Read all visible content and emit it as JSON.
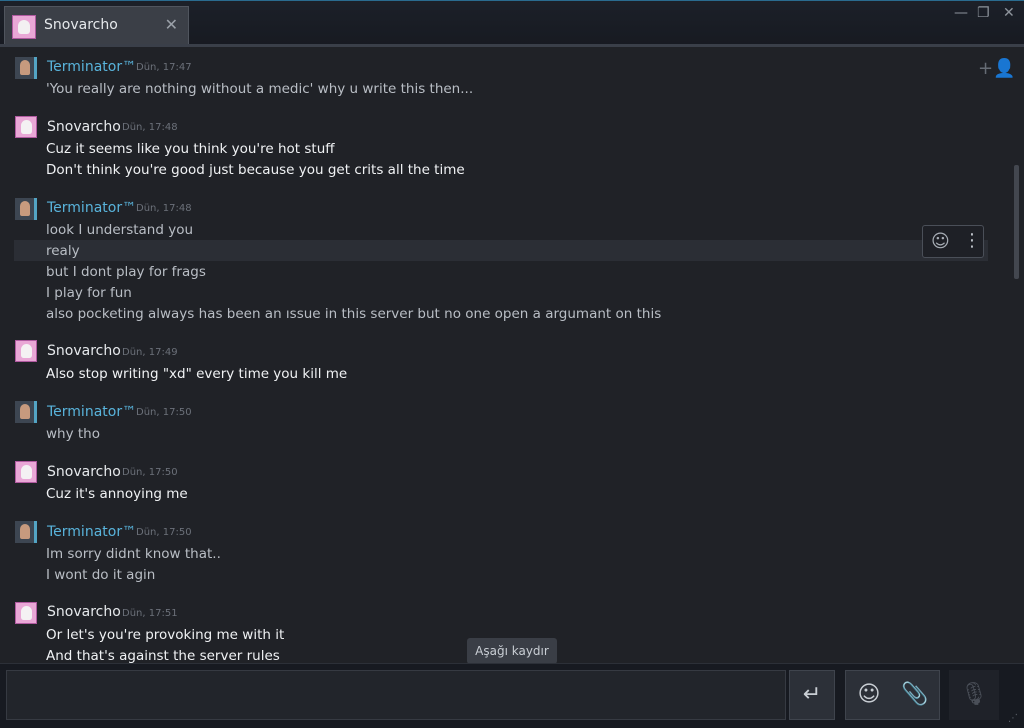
{
  "tab": {
    "title": "Snovarcho",
    "close": "✕"
  },
  "window_controls": {
    "minimize": "—",
    "maximize": "❐",
    "close": "✕"
  },
  "messages": [
    {
      "author": "Terminator™",
      "time": "Dün, 17:47",
      "lines": [
        "'You really are nothing without a medic' why u write this then..."
      ]
    },
    {
      "author": "Snovarcho",
      "time": "Dün, 17:48",
      "lines": [
        "Cuz it seems like you think you're hot stuff",
        "Don't think you're good just because you get crits all the time"
      ]
    },
    {
      "author": "Terminator™",
      "time": "Dün, 17:48",
      "lines": [
        "look I understand you",
        "realy",
        "but I dont play for frags",
        "I play for fun",
        "also pocketing always has been an ıssue in this server but no one open a argumant on this"
      ]
    },
    {
      "author": "Snovarcho",
      "time": "Dün, 17:49",
      "lines": [
        "Also stop writing \"xd\" every time you kill me"
      ]
    },
    {
      "author": "Terminator™",
      "time": "Dün, 17:50",
      "lines": [
        "why tho"
      ]
    },
    {
      "author": "Snovarcho",
      "time": "Dün, 17:50",
      "lines": [
        "Cuz it's annoying me"
      ]
    },
    {
      "author": "Terminator™",
      "time": "Dün, 17:50",
      "lines": [
        "Im sorry didnt know that..",
        "I wont do it agin"
      ]
    },
    {
      "author": "Snovarcho",
      "time": "Dün, 17:51",
      "lines": [
        "Or let's you're provoking me with it",
        "And that's against the server rules"
      ]
    }
  ],
  "scroll_down_label": "Aşağı kaydır",
  "composer": {
    "placeholder": "",
    "send_icon": "↵",
    "emoji_icon": "☺",
    "attach_icon": "📎",
    "mic_icon": "🎙"
  },
  "icons": {
    "add_friend": "+👤",
    "react": "☺",
    "more": "⋮"
  }
}
